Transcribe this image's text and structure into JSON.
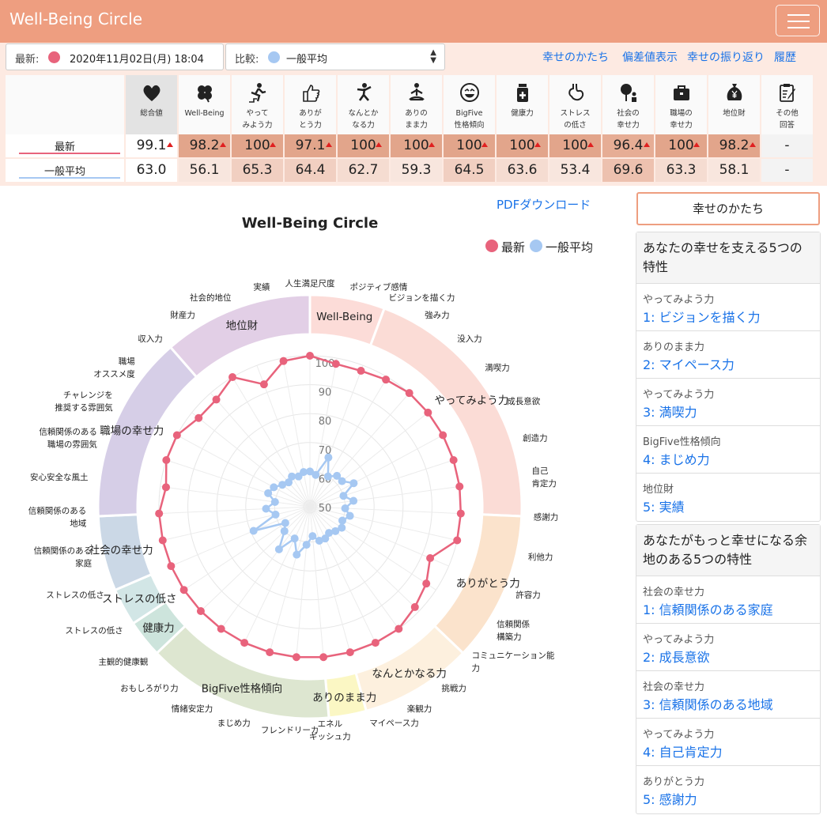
{
  "app": {
    "title": "Well-Being Circle",
    "menu_icon": "hamburger-menu-icon"
  },
  "filters": {
    "latest_label": "最新:",
    "latest_value": "2020年11月02日(月) 18:04",
    "latest_color": "#e8637c",
    "compare_label": "比較:",
    "compare_value": "一般平均",
    "compare_color": "#a6c8f2"
  },
  "nav": {
    "links": [
      "幸せのかたち",
      "偏差値表示",
      "幸せの振り返り",
      "履歴"
    ]
  },
  "scores": {
    "columns": [
      {
        "name": "総合値",
        "icon": "heart-icon",
        "latest": "99.1",
        "average": "63.0",
        "up": true
      },
      {
        "name": "Well-Being",
        "icon": "clover-icon",
        "latest": "98.2",
        "average": "56.1",
        "up": true
      },
      {
        "name": "やって\nみよう力",
        "icon": "running-stairs-icon",
        "latest": "100",
        "average": "65.3",
        "up": true
      },
      {
        "name": "ありが\nとう力",
        "icon": "thumbs-up-icon",
        "latest": "97.1",
        "average": "64.4",
        "up": true
      },
      {
        "name": "なんとか\nなる力",
        "icon": "jumping-person-icon",
        "latest": "100",
        "average": "62.7",
        "up": true
      },
      {
        "name": "ありの\nまま力",
        "icon": "meditation-icon",
        "latest": "100",
        "average": "59.3",
        "up": true
      },
      {
        "name": "BigFive\n性格傾向",
        "icon": "smiley-face-icon",
        "latest": "100",
        "average": "64.5",
        "up": true
      },
      {
        "name": "健康力",
        "icon": "medicine-bottle-icon",
        "latest": "100",
        "average": "63.6",
        "up": true
      },
      {
        "name": "ストレス\nの低さ",
        "icon": "stomach-icon",
        "latest": "100",
        "average": "53.4",
        "up": true
      },
      {
        "name": "社会の\n幸せ力",
        "icon": "tree-people-icon",
        "latest": "96.4",
        "average": "69.6",
        "up": true
      },
      {
        "name": "職場の\n幸せ力",
        "icon": "briefcase-icon",
        "latest": "100",
        "average": "63.3",
        "up": true
      },
      {
        "name": "地位財",
        "icon": "money-bag-icon",
        "latest": "98.2",
        "average": "58.1",
        "up": true
      },
      {
        "name": "その他\n回答",
        "icon": "clipboard-icon",
        "latest": "-",
        "average": "-",
        "up": false
      }
    ],
    "row_labels": [
      "最新",
      "一般平均"
    ]
  },
  "chart": {
    "pdf_link": "PDFダウンロード",
    "title": "Well-Being Circle",
    "legend": [
      "最新",
      "一般平均"
    ]
  },
  "chart_data": {
    "type": "radar",
    "title": "Well-Being Circle",
    "r_range": [
      50,
      100
    ],
    "r_ticks": [
      "50",
      "60",
      "70",
      "80",
      "90",
      "100"
    ],
    "axes": [
      "人生満足尺度",
      "ポジティブ感情",
      "ビジョンを描く力",
      "強み力",
      "没入力",
      "満喫力",
      "成長意欲",
      "創造力",
      "自己\n肯定力",
      "感謝力",
      "利他力",
      "許容力",
      "信頼関係\n構築力",
      "コミュニケーション能\n力",
      "挑戦力",
      "楽観力",
      "マイペース力",
      "エネル\nギッシュ力",
      "フレンドリーカ",
      "まじめ力",
      "情緒安定力",
      "おもしろがり力",
      "主観的健康観",
      "ストレスの低さ",
      "ストレスの低さ",
      "信頼関係のある\n家庭",
      "信頼関係のある\n地域",
      "安心安全な風土",
      "信頼関係のある\n職場の雰囲気",
      "チャレンジを\n推奨する雰囲気",
      "職場\nオススメ度",
      "収入力",
      "財産力",
      "社会的地位",
      "実績"
    ],
    "groups": [
      {
        "name": "Well-Being",
        "start": 0,
        "count": 2,
        "color": "#fcdcd8"
      },
      {
        "name": "やってみよう力",
        "start": 2,
        "count": 7,
        "color": "#fbdcd6"
      },
      {
        "name": "ありがとう力",
        "start": 9,
        "count": 4,
        "color": "#fbe3cc"
      },
      {
        "name": "なんとかなる力",
        "start": 13,
        "count": 3,
        "color": "#fdf0de"
      },
      {
        "name": "ありのまま力",
        "start": 16,
        "count": 1,
        "color": "#fbf7c4"
      },
      {
        "name": "BigFive性格傾向",
        "start": 17,
        "count": 5,
        "color": "#dde6d0"
      },
      {
        "name": "健康力",
        "start": 22,
        "count": 1,
        "color": "#cde4dc"
      },
      {
        "name": "ストレスの低さ",
        "start": 23,
        "count": 1,
        "color": "#d2e6e6"
      },
      {
        "name": "社会の幸せ力",
        "start": 24,
        "count": 2,
        "color": "#cbd8e6"
      },
      {
        "name": "職場の幸せ力",
        "start": 26,
        "count": 5,
        "color": "#d6cee7"
      },
      {
        "name": "地位財",
        "start": 31,
        "count": 4,
        "color": "#e2cfe6"
      }
    ],
    "series": [
      {
        "name": "最新",
        "color": "#e8637c",
        "values": [
          100,
          98,
          98,
          99,
          100,
          100,
          100,
          100,
          100,
          100,
          100,
          93,
          96,
          98,
          100,
          100,
          100,
          100,
          100,
          100,
          100,
          100,
          100,
          100,
          100,
          100,
          100,
          98,
          100,
          100,
          97,
          97,
          100,
          93,
          99
        ]
      },
      {
        "name": "一般平均",
        "color": "#a6c8f2",
        "values": [
          60,
          59,
          66,
          60,
          62,
          62,
          65,
          60,
          63,
          60,
          62,
          60,
          61,
          60,
          59,
          60,
          60,
          58,
          61,
          65,
          60,
          66,
          60,
          58,
          69,
          60,
          63,
          60,
          63,
          62,
          60,
          59,
          60,
          59,
          60
        ]
      }
    ]
  },
  "sidebar": {
    "button": "幸せのかたち",
    "cards": [
      {
        "title": "あなたの幸せを支える5つの\n特性",
        "items": [
          {
            "category": "やってみよう力",
            "link": "1: ビジョンを描く力"
          },
          {
            "category": "ありのまま力",
            "link": "2: マイペース力"
          },
          {
            "category": "やってみよう力",
            "link": "3: 満喫力"
          },
          {
            "category": "BigFive性格傾向",
            "link": "4: まじめ力"
          },
          {
            "category": "地位財",
            "link": "5: 実績"
          }
        ]
      },
      {
        "title": "あなたがもっと幸せになる余\n地のある5つの特性",
        "items": [
          {
            "category": "社会の幸せ力",
            "link": "1: 信頼関係のある家庭"
          },
          {
            "category": "やってみよう力",
            "link": "2: 成長意欲"
          },
          {
            "category": "社会の幸せ力",
            "link": "3: 信頼関係のある地域"
          },
          {
            "category": "やってみよう力",
            "link": "4: 自己肯定力"
          },
          {
            "category": "ありがとう力",
            "link": "5: 感謝力"
          }
        ]
      }
    ]
  }
}
